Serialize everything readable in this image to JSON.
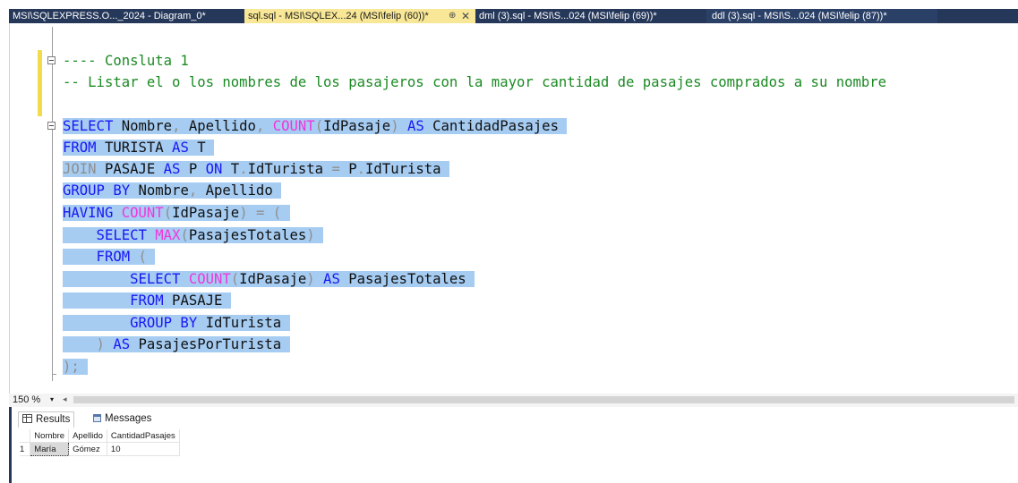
{
  "tabs": {
    "diagram": "MSI\\SQLEXPRESS.O..._2024 - Diagram_0*",
    "active": "sql.sql - MSI\\SQLEX...24 (MSI\\felip (60))*",
    "dml": "dml (3).sql - MSI\\S...024 (MSI\\felip (69))*",
    "ddl": "ddl (3).sql - MSI\\S...024 (MSI\\felip (87))*",
    "pin_glyph": "⊕",
    "close_glyph": "✕"
  },
  "editor": {
    "comment1": "---- Consluta 1",
    "comment2": "-- Listar el o los nombres de los pasajeros con la mayor cantidad de pasajes comprados a su nombre",
    "l1": {
      "a": "SELECT",
      "b": " Nombre",
      "c": ",",
      "d": " Apellido",
      "e": ",",
      "f": " COUNT",
      "g": "(",
      "h": "IdPasaje",
      "i": ")",
      "j": " AS",
      "k": " CantidadPasajes"
    },
    "l2": {
      "a": "FROM",
      "b": " TURISTA",
      "c": " AS",
      "d": " T"
    },
    "l3": {
      "a": "JOIN",
      "b": " PASAJE",
      "c": " AS",
      "d": " P",
      "e": " ON",
      "f": " T",
      "g": ".",
      "h": "IdTurista",
      "i": " =",
      "j": " P",
      "k": ".",
      "l": "IdTurista"
    },
    "l4": {
      "a": "GROUP BY",
      "b": " Nombre",
      "c": ",",
      "d": " Apellido"
    },
    "l5": {
      "a": "HAVING",
      "b": " COUNT",
      "c": "(",
      "d": "IdPasaje",
      "e": ")",
      "f": " =",
      "g": " ("
    },
    "l6": {
      "a": "    SELECT",
      "b": " MAX",
      "c": "(",
      "d": "PasajesTotales",
      "e": ")"
    },
    "l7": {
      "a": "    FROM",
      "b": " ("
    },
    "l8": {
      "a": "        SELECT",
      "b": " COUNT",
      "c": "(",
      "d": "IdPasaje",
      "e": ")",
      "f": " AS",
      "g": " PasajesTotales"
    },
    "l9": {
      "a": "        FROM",
      "b": " PASAJE"
    },
    "l10": {
      "a": "        GROUP BY",
      "b": " IdTurista"
    },
    "l11": {
      "a": "    )",
      "b": " AS",
      "c": " PasajesPorTurista"
    },
    "l12": {
      "a": ");"
    }
  },
  "status": {
    "zoom": "150 %",
    "dropdown_glyph": "▾",
    "scroll_left_glyph": "◂"
  },
  "results": {
    "tab_results": "Results",
    "tab_messages": "Messages",
    "columns": [
      "Nombre",
      "Apellido",
      "CantidadPasajes"
    ],
    "rows": [
      {
        "num": "1",
        "cells": [
          "María",
          "Gómez",
          "10"
        ]
      }
    ]
  }
}
